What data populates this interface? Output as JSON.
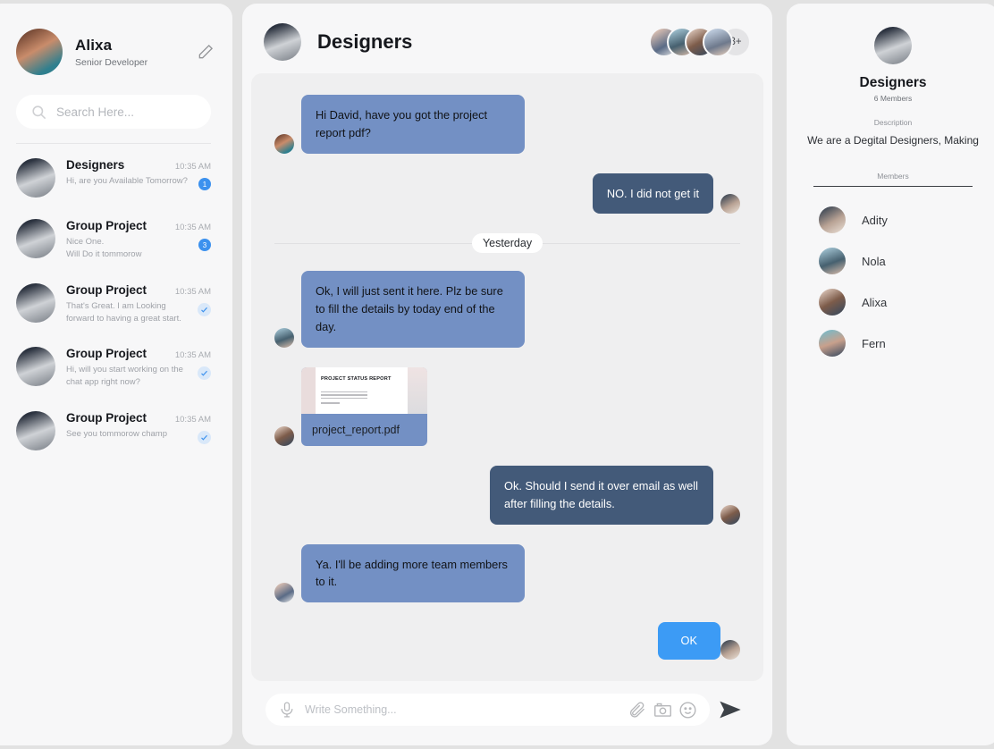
{
  "profile": {
    "name": "Alixa",
    "role": "Senior Developer",
    "edit_icon": "pencil-icon"
  },
  "search": {
    "placeholder": "Search Here...",
    "value": "",
    "icon": "search-icon"
  },
  "chat_list": [
    {
      "title": "Designers",
      "time": "10:35 AM",
      "snippet": "Hi, are you Available Tomorrow?",
      "status": "badge",
      "badge": "1",
      "active": true
    },
    {
      "title": "Group Project",
      "time": "10:35 AM",
      "snippet": "Nice One.\nWill Do it tommorow",
      "status": "badge",
      "badge": "3",
      "active": false
    },
    {
      "title": "Group Project",
      "time": "10:35 AM",
      "snippet": "That's Great. I am Looking\nforward to having a great start.",
      "status": "tick",
      "badge": "",
      "active": false
    },
    {
      "title": "Group Project",
      "time": "10:35 AM",
      "snippet": "Hi, will you start working on the\nchat app right now?",
      "status": "tick",
      "badge": "",
      "active": false
    },
    {
      "title": "Group Project",
      "time": "10:35 AM",
      "snippet": "See you tommorow champ",
      "status": "tick",
      "badge": "",
      "active": false
    }
  ],
  "conversation": {
    "title": "Designers",
    "more_members": "3+",
    "day_separator": "Yesterday",
    "messages": [
      {
        "type": "text",
        "side": "in",
        "text": "Hi David, have you got the project report pdf?"
      },
      {
        "type": "text",
        "side": "out",
        "text": "NO. I did not get it"
      },
      {
        "type": "text",
        "side": "in",
        "text": "Ok, I will just sent it here. Plz be sure to fill the details by today end of the day."
      },
      {
        "type": "file",
        "side": "in",
        "file_name": "project_report.pdf",
        "thumb_title": "PROJECT\nSTATUS REPORT"
      },
      {
        "type": "text",
        "side": "out",
        "text": "Ok. Should I send it over email as well after filling the details."
      },
      {
        "type": "text",
        "side": "in",
        "text": "Ya. I'll be adding more team members to it."
      },
      {
        "type": "text",
        "side": "out",
        "text": "OK",
        "style": "ok"
      }
    ]
  },
  "composer": {
    "placeholder": "Write Something...",
    "value": "",
    "mic_icon": "microphone-icon",
    "attach_icon": "paperclip-icon",
    "camera_icon": "camera-icon",
    "emoji_icon": "smiley-icon",
    "send_icon": "send-icon"
  },
  "info": {
    "title": "Designers",
    "members_count": "6 Members",
    "description_label": "Description",
    "description": "We are a Degital Designers, Making",
    "members_label": "Members",
    "members": [
      {
        "name": "Adity"
      },
      {
        "name": "Nola"
      },
      {
        "name": "Alixa"
      },
      {
        "name": "Fern"
      }
    ]
  },
  "colors": {
    "page_bg": "#e2e2e2",
    "panel_bg": "#f7f7f8",
    "messages_bg": "#efeff0",
    "bubble_in": "#7390c4",
    "bubble_out": "#435a79",
    "bubble_ok": "#3c9bf5",
    "badge": "#3c91ee",
    "tick_bg": "#d9e8f9"
  }
}
